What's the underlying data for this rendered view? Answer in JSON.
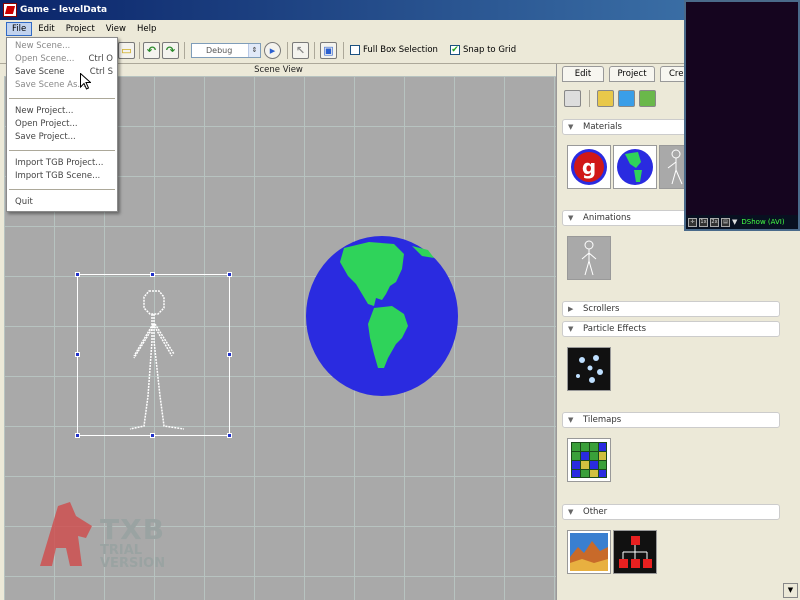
{
  "window": {
    "title": "Game - levelData"
  },
  "menubar": {
    "items": [
      "File",
      "Edit",
      "Project",
      "View",
      "Help"
    ]
  },
  "toolbar": {
    "config_select": "Debug",
    "full_box_selection": "Full Box Selection",
    "snap_to_grid": "Snap to Grid",
    "full_box_checked": false,
    "snap_checked": true
  },
  "scene": {
    "header": "Scene View"
  },
  "file_menu": {
    "new_scene": "New Scene...",
    "open_scene": "Open Scene...",
    "open_scene_shortcut": "Ctrl O",
    "save_scene": "Save Scene",
    "save_scene_shortcut": "Ctrl S",
    "save_scene_as": "Save Scene As...",
    "new_project": "New Project...",
    "open_project": "Open Project...",
    "save_project": "Save Project...",
    "import_tgb_project": "Import TGB Project...",
    "import_tgb_scene": "Import TGB Scene...",
    "quit": "Quit"
  },
  "watermark": {
    "line1": "TXB",
    "line2": "TRIAL",
    "line3": "VERSION"
  },
  "right_panel": {
    "tabs": [
      "Edit",
      "Project",
      "Crea"
    ],
    "sections": {
      "materials": "Materials",
      "animations": "Animations",
      "scrollers": "Scrollers",
      "particle_effects": "Particle Effects",
      "tilemaps": "Tilemaps",
      "other": "Other"
    }
  },
  "ds_window": {
    "status": "DShow (AVI)"
  },
  "colors": {
    "title_start": "#0a246a",
    "earth_ocean": "#2a2be0",
    "earth_land": "#2fd35a",
    "watermark_red": "#d04a4a"
  }
}
